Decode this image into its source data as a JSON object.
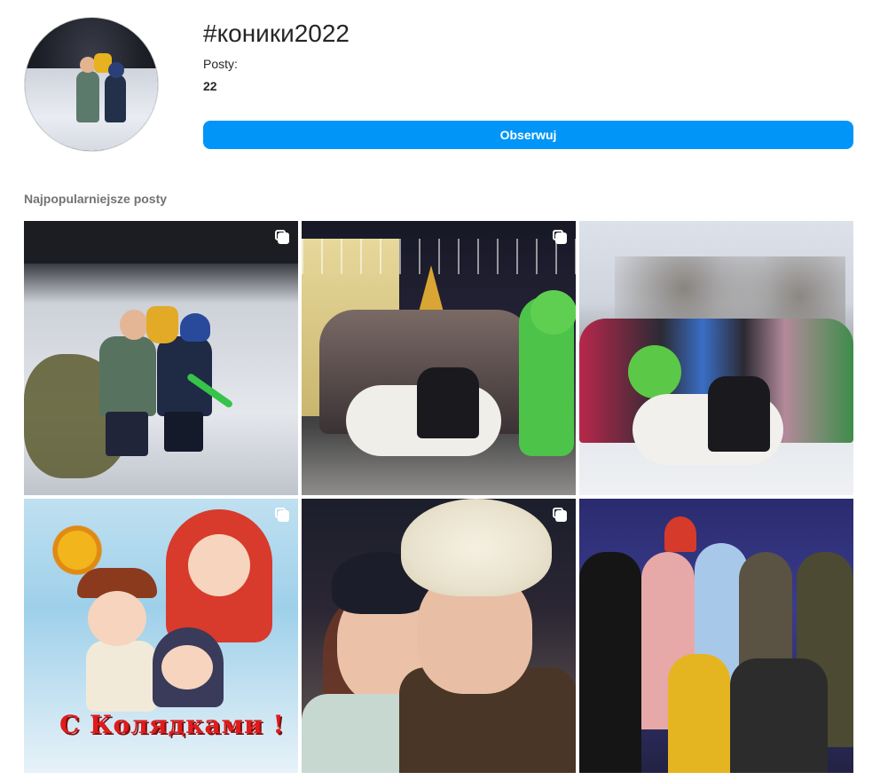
{
  "header": {
    "hashtag": "#коники2022",
    "posts_label": "Posty:",
    "posts_count": "22",
    "follow_label": "Obserwuj"
  },
  "section": {
    "title": "Najpopularniejsze posty"
  },
  "posts": [
    {
      "alt": "children in snow at night",
      "multi": true
    },
    {
      "alt": "night party with horse costume",
      "multi": true
    },
    {
      "alt": "daytime carnival with horse costume",
      "multi": false
    },
    {
      "alt": "Christmas card",
      "caption": "С Колядками !",
      "multi": true
    },
    {
      "alt": "selfie",
      "multi": true
    },
    {
      "alt": "stage costumes",
      "multi": false
    }
  ],
  "colors": {
    "accent": "#0095f6",
    "text": "#262626",
    "muted": "#737373"
  }
}
